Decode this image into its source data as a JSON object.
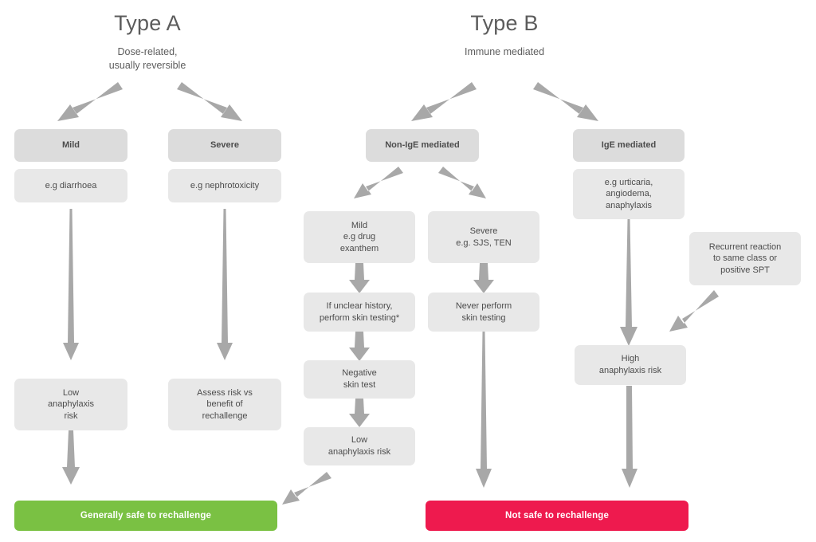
{
  "diagram": {
    "title": "Drug reaction rechallenge decision flowchart",
    "colors": {
      "box_light": "#e8e8e8",
      "box_header": "#dcdcdc",
      "arrow": "#a8a8a8",
      "text": "#4c4c4c",
      "title_text": "#5c5c5c",
      "safe_green": "#7ac143",
      "unsafe_red": "#ee1a4e"
    }
  },
  "columns": {
    "type_a": {
      "title": "Type A",
      "subtitle": "Dose-related,\nusually reversible"
    },
    "type_b": {
      "title": "Type B",
      "subtitle": "Immune mediated"
    }
  },
  "nodes": {
    "a_mild_header": "Mild",
    "a_mild_example": "e.g diarrhoea",
    "a_mild_outcome": "Low\nanaphylaxis\nrisk",
    "a_severe_header": "Severe",
    "a_severe_example": "e.g nephrotoxicity",
    "a_severe_outcome": "Assess risk vs\nbenefit of\nrechallenge",
    "b_non_ige_header": "Non-IgE mediated",
    "b_non_ige_mild": "Mild\ne.g drug\nexanthem",
    "b_non_ige_mild_step2": "If unclear history,\nperform skin testing*",
    "b_non_ige_mild_step3": "Negative\nskin test",
    "b_non_ige_mild_step4": "Low\nanaphylaxis risk",
    "b_non_ige_severe": "Severe\ne.g. SJS, TEN",
    "b_non_ige_severe_step2": "Never perform\nskin testing",
    "b_ige_header": "IgE mediated",
    "b_ige_example": "e.g urticaria,\nangiodema,\nanaphylaxis",
    "b_ige_recurrent": "Recurrent reaction\nto same class or\npositive SPT",
    "b_ige_outcome": "High\nanaphylaxis risk"
  },
  "outcomes": {
    "safe": "Generally safe to rechallenge",
    "unsafe": "Not safe to rechallenge"
  }
}
